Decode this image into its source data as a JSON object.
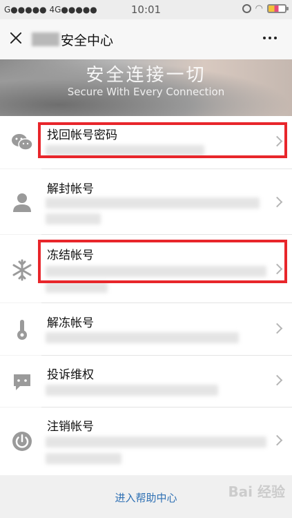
{
  "status_bar": {
    "carrier": "G●●●●● 4G●●●●●",
    "time": "10:01"
  },
  "header": {
    "title": "安全中心"
  },
  "banner": {
    "title_cn": "安全连接一切",
    "title_en": "Secure With Every Connection"
  },
  "items": [
    {
      "label": "找回帐号密码",
      "icon": "wechat-chat-icon",
      "highlighted": true
    },
    {
      "label": "解封帐号",
      "icon": "person-icon",
      "highlighted": false
    },
    {
      "label": "冻结帐号",
      "icon": "snowflake-icon",
      "highlighted": true
    },
    {
      "label": "解冻帐号",
      "icon": "key-icon",
      "highlighted": false
    },
    {
      "label": "投诉维权",
      "icon": "chat-bubble-icon",
      "highlighted": false
    },
    {
      "label": "注销帐号",
      "icon": "power-icon",
      "highlighted": false
    }
  ],
  "footer": {
    "help_link": "进入帮助中心"
  },
  "watermark": "Bai 经验",
  "colors": {
    "highlight": "#e8262b",
    "link": "#2d6fb3"
  }
}
